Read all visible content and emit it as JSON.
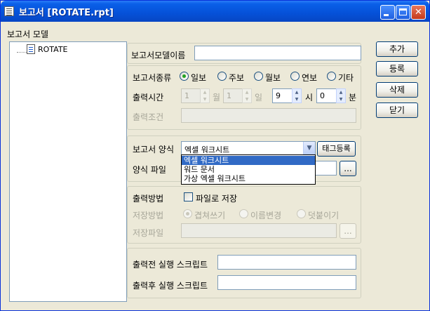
{
  "window": {
    "title": "보고서 [ROTATE.rpt]"
  },
  "left_panel": {
    "label": "보고서 모델",
    "tree_items": [
      {
        "label": "ROTATE",
        "icon": "report-doc-icon"
      }
    ]
  },
  "form": {
    "model_name_label": "보고서모델이름",
    "model_name_value": "",
    "report_type": {
      "label": "보고서종류",
      "options": [
        "일보",
        "주보",
        "월보",
        "연보",
        "기타"
      ],
      "selected": "일보"
    },
    "output_time": {
      "label": "출력시간",
      "month_value": "1",
      "month_unit": "월",
      "day_value": "1",
      "day_unit": "일",
      "hour_value": "9",
      "hour_unit": "시",
      "minute_value": "0",
      "minute_unit": "분"
    },
    "output_condition": {
      "label": "출력조건",
      "value": ""
    },
    "report_format": {
      "label": "보고서 양식",
      "selected": "엑셀 워크시트",
      "options": [
        "엑셀 워크시트",
        "워드 문서",
        "가상 엑셀 워크시트"
      ],
      "tag_button": "태그등록"
    },
    "format_file": {
      "label": "양식 파일",
      "value": "",
      "browse": "..."
    },
    "output_method": {
      "label": "출력방법",
      "save_to_file_label": "파일로 저장",
      "save_to_file_checked": false
    },
    "save_method": {
      "label": "저장방법",
      "options": [
        "겹쳐쓰기",
        "이름변경",
        "덧붙이기"
      ],
      "selected": "겹쳐쓰기"
    },
    "save_file": {
      "label": "저장파일",
      "value": "",
      "browse": "..."
    },
    "pre_script": {
      "label": "출력전 실행 스크립트",
      "value": ""
    },
    "post_script": {
      "label": "출력후 실행 스크립트",
      "value": ""
    }
  },
  "buttons": {
    "add": "추가",
    "register": "등록",
    "delete": "삭제",
    "close": "닫기"
  }
}
